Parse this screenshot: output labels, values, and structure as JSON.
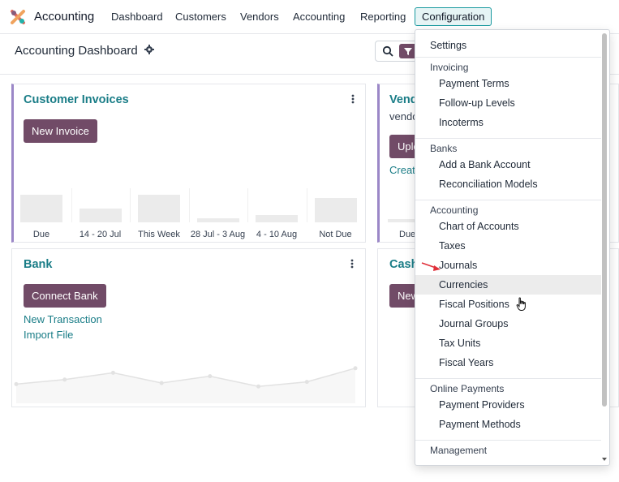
{
  "app": {
    "name": "Accounting",
    "logo": "odoo-accounting-logo",
    "accent": "#714b67",
    "teal": "#1a7d87"
  },
  "navbar": {
    "items": [
      {
        "label": "Dashboard"
      },
      {
        "label": "Customers"
      },
      {
        "label": "Vendors"
      },
      {
        "label": "Accounting"
      },
      {
        "label": "Reporting"
      },
      {
        "label": "Configuration",
        "active": true
      }
    ]
  },
  "control_panel": {
    "title": "Accounting Dashboard"
  },
  "cards": {
    "customer_invoices": {
      "title": "Customer Invoices",
      "button": "New Invoice",
      "bars": [
        {
          "label": "Due",
          "value": 0.45
        },
        {
          "label": "14 - 20 Jul",
          "value": 0.22
        },
        {
          "label": "This Week",
          "value": 0.45
        },
        {
          "label": "28 Jul - 3 Aug",
          "value": 0.06
        },
        {
          "label": "4 - 10 Aug",
          "value": 0.12
        },
        {
          "label": "Not Due",
          "value": 0.4
        }
      ]
    },
    "vendor_bills": {
      "title": "Vend",
      "subtitle": "vendo",
      "button": "Uplo",
      "link": "Creat",
      "axis_label": "Due"
    },
    "bank": {
      "title": "Bank",
      "button": "Connect Bank",
      "links": [
        "New Transaction",
        "Import File"
      ],
      "line_values": [
        0.2,
        0.4,
        0.7,
        0.25,
        0.55,
        0.1,
        0.3,
        0.9
      ]
    },
    "cash": {
      "title": "Cash",
      "button": "New"
    }
  },
  "dropdown": {
    "settings": "Settings",
    "sections": [
      {
        "header": "Invoicing",
        "items": [
          "Payment Terms",
          "Follow-up Levels",
          "Incoterms"
        ]
      },
      {
        "header": "Banks",
        "items": [
          "Add a Bank Account",
          "Reconciliation Models"
        ]
      },
      {
        "header": "Accounting",
        "items": [
          "Chart of Accounts",
          "Taxes",
          "Journals",
          "Currencies",
          "Fiscal Positions",
          "Journal Groups",
          "Tax Units",
          "Fiscal Years"
        ]
      },
      {
        "header": "Online Payments",
        "items": [
          "Payment Providers",
          "Payment Methods"
        ]
      },
      {
        "header": "Management",
        "items": []
      }
    ],
    "hovered_item": "Currencies"
  }
}
